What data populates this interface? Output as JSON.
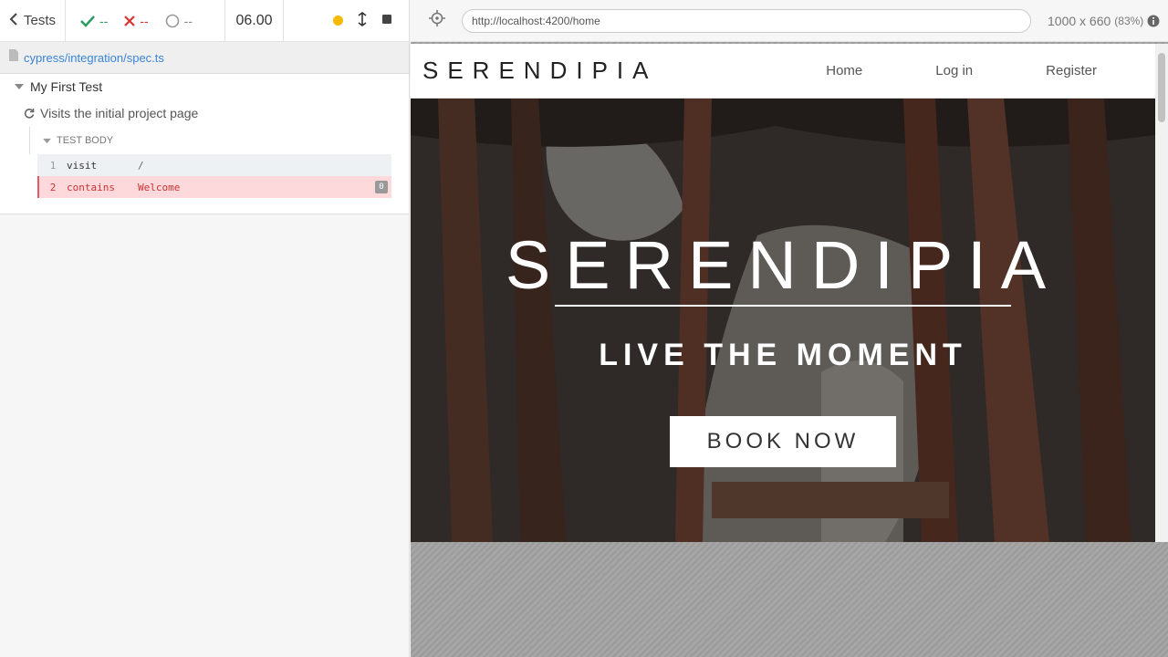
{
  "reporter": {
    "back_label": "Tests",
    "passed": "--",
    "failed": "--",
    "pending": "--",
    "duration": "06.00",
    "spec_file": "cypress/integration/spec.ts",
    "suite_title": "My First Test",
    "test_title": "Visits the initial project page",
    "body_label": "TEST BODY",
    "commands": [
      {
        "num": "1",
        "name": "visit",
        "message": "/"
      },
      {
        "num": "2",
        "name": "contains",
        "message": "Welcome",
        "badge": "0"
      }
    ]
  },
  "aut": {
    "url": "http://localhost:4200/home",
    "viewport": "1000 x 660",
    "scale": "(83%)"
  },
  "site": {
    "logo": "SERENDIPIA",
    "nav": [
      "Home",
      "Log in",
      "Register"
    ],
    "hero_title": "SERENDIPIA",
    "hero_subtitle": "LIVE THE MOMENT",
    "cta": "BOOK NOW"
  }
}
